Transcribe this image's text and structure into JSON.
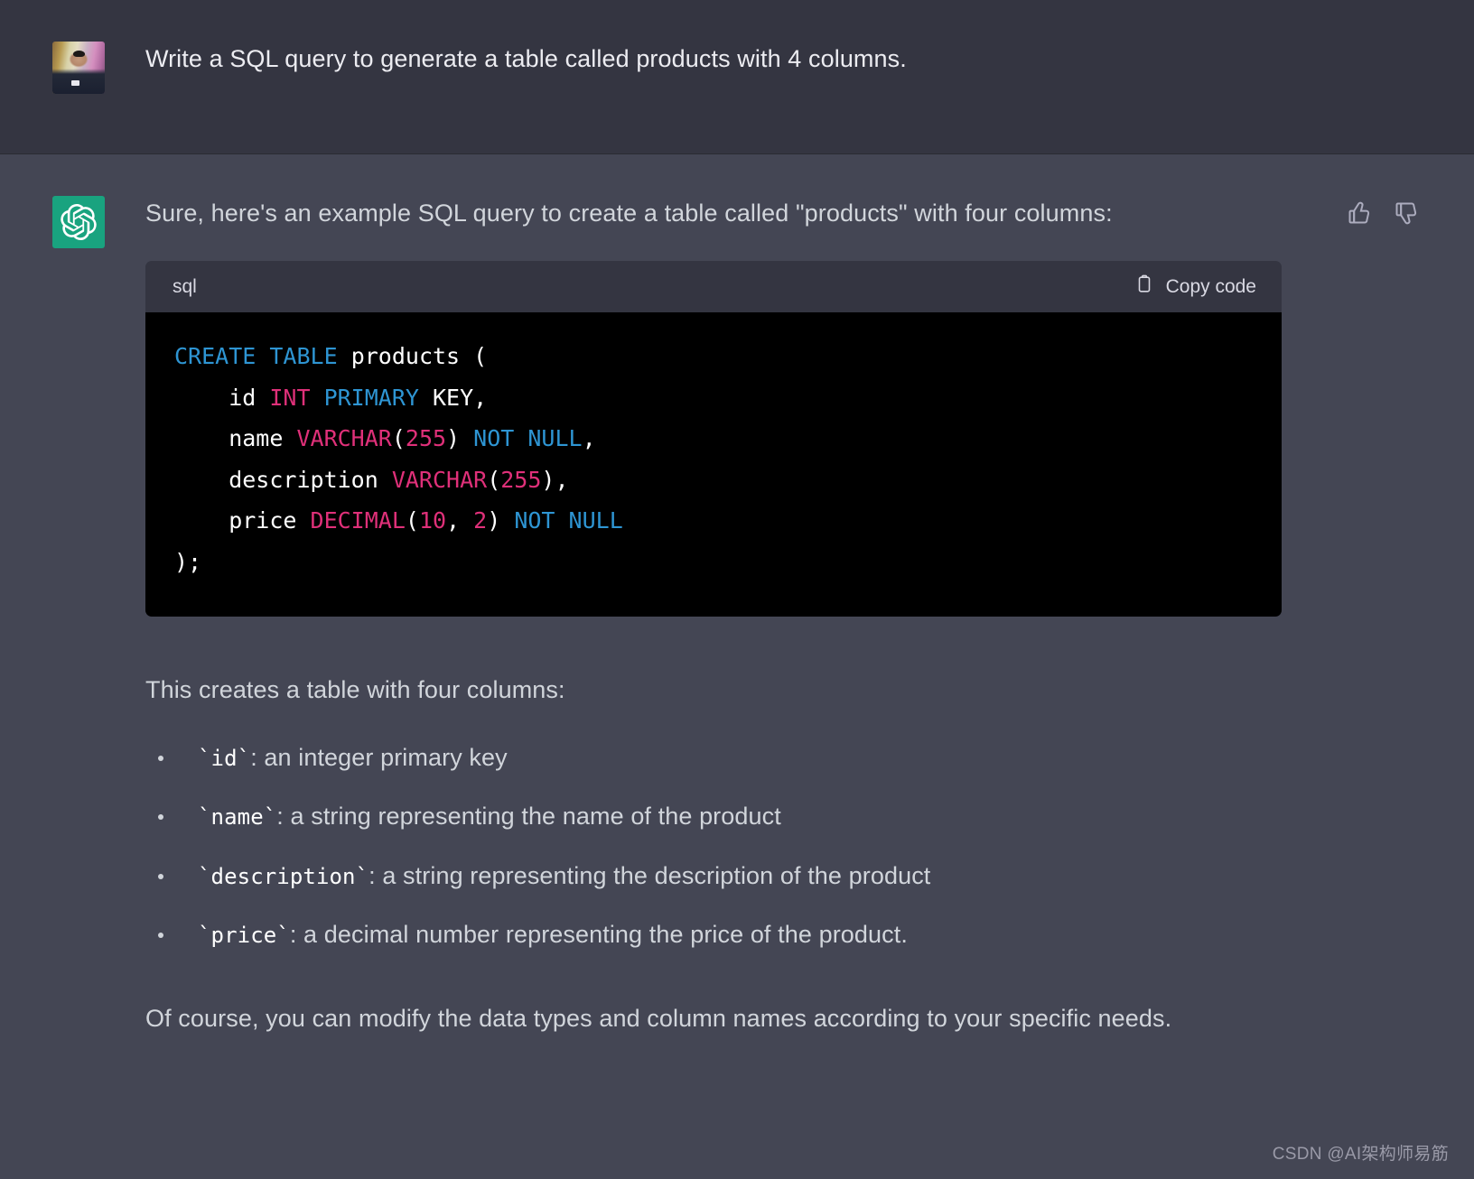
{
  "conversation": {
    "user": {
      "avatar_name": "user-photo-avatar",
      "message": "Write a SQL query to generate a table called products with 4 columns."
    },
    "assistant": {
      "avatar_name": "openai-logo-icon",
      "intro": "Sure, here's an example SQL query to create a table called \"products\" with four columns:",
      "feedback": {
        "thumbs_up_label": "thumb-up-icon",
        "thumbs_down_label": "thumb-down-icon"
      },
      "code_block": {
        "language": "sql",
        "copy_label": "Copy code",
        "copy_icon": "clipboard-icon",
        "lines": [
          [
            {
              "t": "CREATE",
              "c": "k"
            },
            {
              "t": " ",
              "c": "p"
            },
            {
              "t": "TABLE",
              "c": "k"
            },
            {
              "t": " products (",
              "c": "p"
            }
          ],
          [
            {
              "t": "    id ",
              "c": "p"
            },
            {
              "t": "INT",
              "c": "t"
            },
            {
              "t": " ",
              "c": "p"
            },
            {
              "t": "PRIMARY",
              "c": "k"
            },
            {
              "t": " KEY,",
              "c": "p"
            }
          ],
          [
            {
              "t": "    name ",
              "c": "p"
            },
            {
              "t": "VARCHAR",
              "c": "t"
            },
            {
              "t": "(",
              "c": "p"
            },
            {
              "t": "255",
              "c": "t"
            },
            {
              "t": ") ",
              "c": "p"
            },
            {
              "t": "NOT",
              "c": "k"
            },
            {
              "t": " ",
              "c": "p"
            },
            {
              "t": "NULL",
              "c": "k"
            },
            {
              "t": ",",
              "c": "p"
            }
          ],
          [
            {
              "t": "    description ",
              "c": "p"
            },
            {
              "t": "VARCHAR",
              "c": "t"
            },
            {
              "t": "(",
              "c": "p"
            },
            {
              "t": "255",
              "c": "t"
            },
            {
              "t": "),",
              "c": "p"
            }
          ],
          [
            {
              "t": "    price ",
              "c": "p"
            },
            {
              "t": "DECIMAL",
              "c": "t"
            },
            {
              "t": "(",
              "c": "p"
            },
            {
              "t": "10",
              "c": "t"
            },
            {
              "t": ", ",
              "c": "p"
            },
            {
              "t": "2",
              "c": "t"
            },
            {
              "t": ") ",
              "c": "p"
            },
            {
              "t": "NOT",
              "c": "k"
            },
            {
              "t": " ",
              "c": "p"
            },
            {
              "t": "NULL",
              "c": "k"
            }
          ],
          [
            {
              "t": ");",
              "c": "p"
            }
          ]
        ]
      },
      "explanation_lead": "This creates a table with four columns:",
      "bullets": [
        {
          "code": "`id`",
          "text": ": an integer primary key"
        },
        {
          "code": "`name`",
          "text": ": a string representing the name of the product"
        },
        {
          "code": "`description`",
          "text": ": a string representing the description of the product"
        },
        {
          "code": "`price`",
          "text": ": a decimal number representing the price of the product."
        }
      ],
      "closing": "Of course, you can modify the data types and column names according to your specific needs."
    }
  },
  "watermark": "CSDN @AI架构师易筋",
  "colors": {
    "user_bg": "#343541",
    "assistant_bg": "#444654",
    "code_header_bg": "#343541",
    "code_body_bg": "#000000",
    "accent_green": "#19a37f",
    "keyword_blue": "#2e95d3",
    "type_crimson": "#df3079",
    "text_primary": "#ececf1",
    "text_secondary": "#d1d5db"
  }
}
